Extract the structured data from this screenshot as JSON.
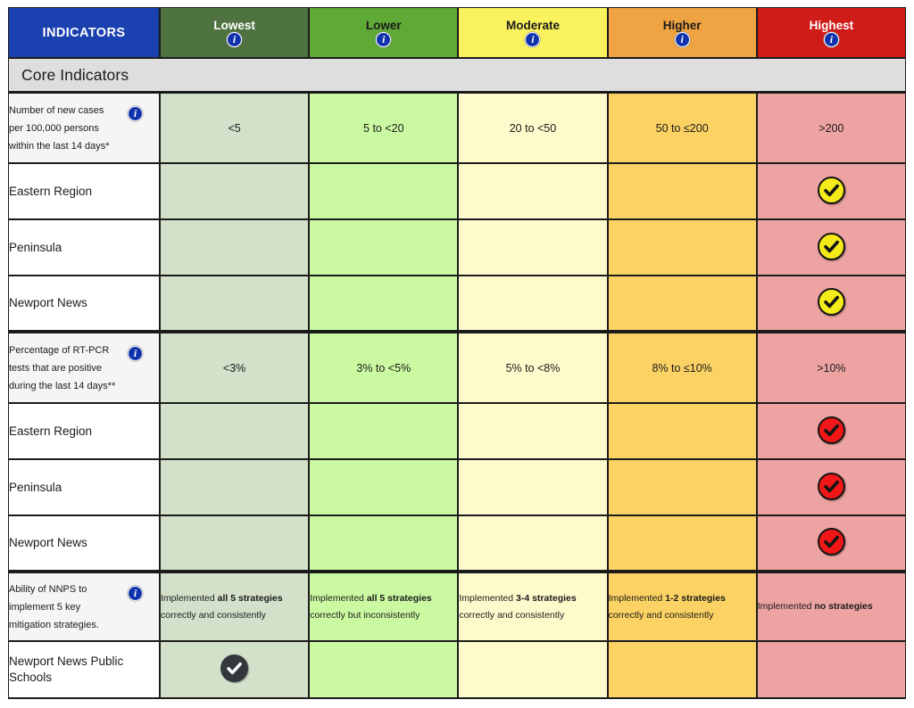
{
  "header": {
    "indicators_label": "INDICATORS",
    "bands": [
      {
        "label": "Lowest",
        "color": "#4f7340",
        "text_color": "#ffffff",
        "info_icon": "info-icon"
      },
      {
        "label": "Lower",
        "color": "#5faa37",
        "text_color": "#1b1b1b",
        "info_icon": "info-icon"
      },
      {
        "label": "Moderate",
        "color": "#f9f25e",
        "text_color": "#1b1b1b",
        "info_icon": "info-icon"
      },
      {
        "label": "Higher",
        "color": "#efa342",
        "text_color": "#1b1b1b",
        "info_icon": "info-icon"
      },
      {
        "label": "Highest",
        "color": "#d01c18",
        "text_color": "#ffffff",
        "info_icon": "info-icon"
      }
    ]
  },
  "section": {
    "title": "Core Indicators"
  },
  "colors": {
    "band_lowest_cell": "#d3e0ca",
    "band_lower_cell": "#cbf9a2",
    "band_moderate_cell": "#fdfacb",
    "band_higher_cell": "#fbd263",
    "band_highest_cell": "#eda3a2",
    "indicators_header": "#1b41b0",
    "section_band": "#dedede",
    "info_icon_blue": "#1033ad",
    "mark_yellow": "#f5ea1a",
    "mark_red": "#ef1717",
    "mark_dark": "#33383d"
  },
  "indicator_groups": [
    {
      "criterion": {
        "line1": "Number of new cases",
        "line2": "per 100,000 persons",
        "line3": "within the last 14 days*",
        "info_icon": "info-icon",
        "thresholds": {
          "lowest": "<5",
          "lower": "5 to <20",
          "moderate": "20 to <50",
          "higher": "50 to ≤200",
          "highest": ">200"
        }
      },
      "rows": [
        {
          "label": "Eastern Region",
          "mark_column": "highest",
          "mark_style": "yellow",
          "mark_icon": "check-circle-icon"
        },
        {
          "label": "Peninsula",
          "mark_column": "highest",
          "mark_style": "yellow",
          "mark_icon": "check-circle-icon"
        },
        {
          "label": "Newport News",
          "mark_column": "highest",
          "mark_style": "yellow",
          "mark_icon": "check-circle-icon"
        }
      ]
    },
    {
      "criterion": {
        "line1": "Percentage of RT-PCR",
        "line2": "tests that are positive",
        "line3": "during the last 14 days**",
        "info_icon": "info-icon",
        "thresholds": {
          "lowest": "<3%",
          "lower": "3% to <5%",
          "moderate": "5% to <8%",
          "higher": "8% to ≤10%",
          "highest": ">10%"
        }
      },
      "rows": [
        {
          "label": "Eastern Region",
          "mark_column": "highest",
          "mark_style": "red",
          "mark_icon": "check-circle-icon"
        },
        {
          "label": "Peninsula",
          "mark_column": "highest",
          "mark_style": "red",
          "mark_icon": "check-circle-icon"
        },
        {
          "label": "Newport News",
          "mark_column": "highest",
          "mark_style": "red",
          "mark_icon": "check-circle-icon"
        }
      ]
    },
    {
      "criterion": {
        "line1": "Ability of NNPS to",
        "line2": "implement 5 key",
        "line3": "mitigation strategies.",
        "info_icon": "info-icon",
        "strategies": {
          "lowest": {
            "prefix": "Implemented ",
            "bold": "all 5 strategies",
            "line2": "correctly and consistently"
          },
          "lower": {
            "prefix": "Implemented ",
            "bold": "all 5 strategies",
            "line2": "correctly but inconsistently"
          },
          "moderate": {
            "prefix": "Implemented ",
            "bold": "3-4 strategies",
            "line2": "correctly and consistently"
          },
          "higher": {
            "prefix": "Implemented ",
            "bold": "1-2 strategies",
            "line2": "correctly and consistently"
          },
          "highest": {
            "prefix": "Implemented ",
            "bold": "no strategies",
            "line2": ""
          }
        }
      },
      "rows": [
        {
          "label": "Newport News Public Schools",
          "mark_column": "lowest",
          "mark_style": "dark",
          "mark_icon": "check-circle-icon"
        }
      ]
    }
  ]
}
